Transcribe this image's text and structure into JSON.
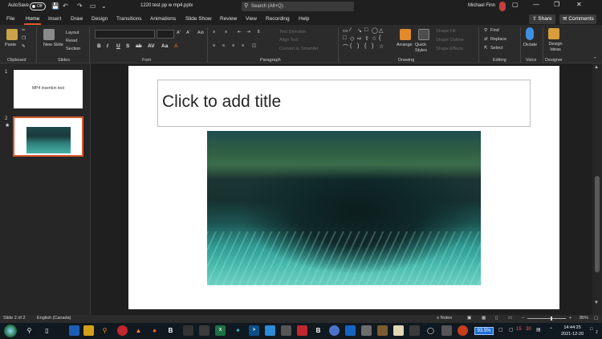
{
  "titlebar": {
    "autosave_label": "AutoSave",
    "autosave_state": "Off",
    "document_title": "1220 test pp w mp4.pptx",
    "search_placeholder": "Search (Alt+Q)",
    "user_name": "Michael Finn"
  },
  "menu": {
    "tabs": [
      "File",
      "Home",
      "Insert",
      "Draw",
      "Design",
      "Transitions",
      "Animations",
      "Slide Show",
      "Review",
      "View",
      "Recording",
      "Help"
    ],
    "active_tab": "Home",
    "share_label": "Share",
    "comments_label": "Comments"
  },
  "ribbon": {
    "groups": {
      "clipboard": "Clipboard",
      "slides": "Slides",
      "font": "Font",
      "paragraph": "Paragraph",
      "drawing": "Drawing",
      "editing": "Editing",
      "voice": "Voice",
      "designer": "Designer"
    },
    "paste": "Paste",
    "new_slide": "New Slide",
    "layout": "Layout",
    "reset": "Reset",
    "section": "Section",
    "font_format": [
      "B",
      "I",
      "U",
      "S",
      "ab",
      "AV",
      "Aa",
      "A"
    ],
    "text_direction": "Text Direction",
    "align_text": "Align Text",
    "convert_smartart": "Convert to SmartArt",
    "arrange": "Arrange",
    "quick_styles": "Quick Styles",
    "shape_fill": "Shape Fill",
    "shape_outline": "Shape Outline",
    "shape_effects": "Shape Effects",
    "find": "Find",
    "replace": "Replace",
    "select": "Select",
    "dictate": "Dictate",
    "design_ideas": "Design Ideas"
  },
  "slides_panel": {
    "slides": [
      {
        "number": "1",
        "text": "MP4 insertion test"
      },
      {
        "number": "2",
        "text": ""
      }
    ],
    "selected": "2"
  },
  "slide": {
    "title_placeholder": "Click to add title"
  },
  "statusbar": {
    "slide_counter": "Slide 2 of 2",
    "language": "English (Canada)",
    "notes": "Notes",
    "zoom": "86%"
  },
  "taskbar": {
    "active_zoom": "93.5%",
    "tray_numbers": [
      "15",
      "30"
    ],
    "time": "14:44:25",
    "date": "2021-12-20",
    "notification_count": "2"
  },
  "colors": {
    "accent": "#d8592e",
    "ribbon_bg": "#2b2b2b",
    "window_bg": "#1f1f1f"
  }
}
